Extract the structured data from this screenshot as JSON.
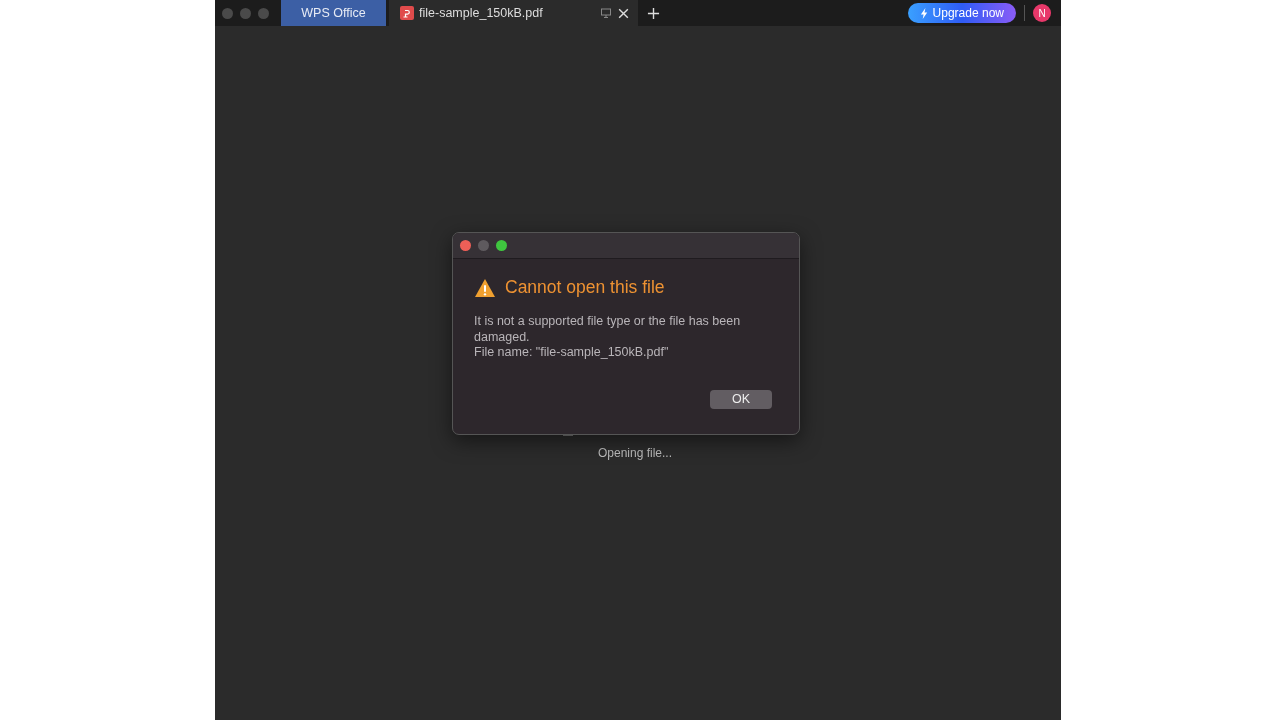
{
  "tabs": [
    {
      "kind": "home",
      "label": "WPS Office"
    },
    {
      "kind": "document",
      "label": "file-sample_150kB.pdf"
    }
  ],
  "upgrade_button": {
    "label": "Upgrade now"
  },
  "avatar": {
    "initial": "N"
  },
  "status": {
    "text": "Opening file..."
  },
  "dialog": {
    "title": "Cannot open this file",
    "message": "It is not a supported file type or the file has been damaged.",
    "file_name": "File name: \"file-sample_150kB.pdf\"",
    "buttons": [
      "OK"
    ]
  }
}
